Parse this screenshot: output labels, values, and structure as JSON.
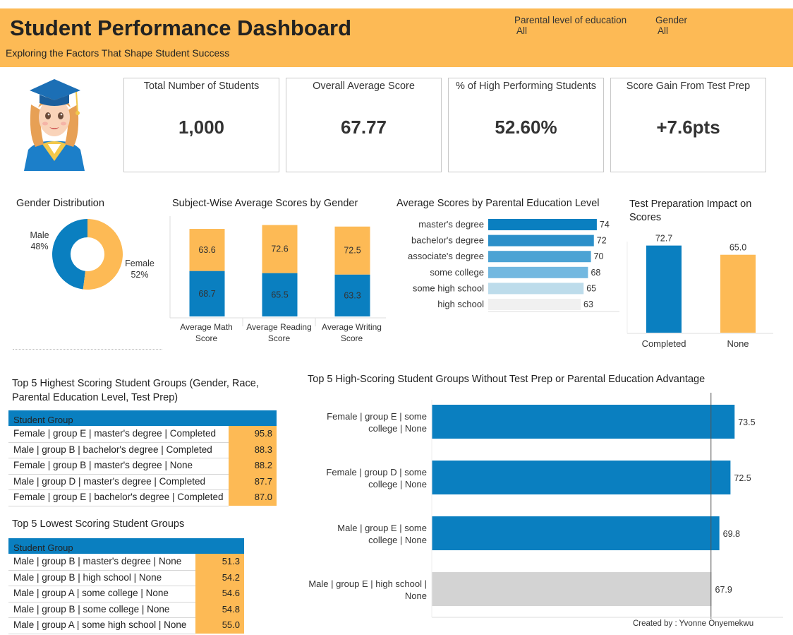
{
  "header": {
    "title": "Student Performance Dashboard",
    "subtitle": "Exploring the Factors That Shape Student Success",
    "filters": [
      {
        "label": "Parental level of education",
        "value": "All"
      },
      {
        "label": "Gender",
        "value": "All"
      }
    ]
  },
  "kpis": [
    {
      "label": "Total Number of  Students",
      "value": "1,000"
    },
    {
      "label": "Overall Average Score",
      "value": "67.77"
    },
    {
      "label": "% of High Performing Students",
      "value": "52.60%"
    },
    {
      "label": "Score Gain From Test Prep",
      "value": "+7.6pts"
    }
  ],
  "colors": {
    "orange": "#FDBA55",
    "blue": "#0A7FC0",
    "gray": "#D3D3D3"
  },
  "tables": {
    "top": {
      "title": "Top 5 Highest Scoring Student Groups (Gender, Race, Parental Education Level, Test Prep)",
      "header": "Student Group",
      "rows": [
        {
          "group": "Female | group E | master's degree | Completed",
          "value": "95.8"
        },
        {
          "group": "Male | group B | bachelor's degree | Completed",
          "value": "88.3"
        },
        {
          "group": "Female | group B | master's degree | None",
          "value": "88.2"
        },
        {
          "group": "Male | group D | master's degree | Completed",
          "value": "87.7"
        },
        {
          "group": "Female | group E | bachelor's degree | Completed",
          "value": "87.0"
        }
      ]
    },
    "bottom": {
      "title": "Top 5 Lowest Scoring Student Groups",
      "header": "Student Group",
      "rows": [
        {
          "group": "Male | group B | master's degree | None",
          "value": "51.3"
        },
        {
          "group": "Male | group B | high school | None",
          "value": "54.2"
        },
        {
          "group": "Male | group A | some college | None",
          "value": "54.6"
        },
        {
          "group": "Male | group B | some college | None",
          "value": "54.8"
        },
        {
          "group": "Male | group A | some high school | None",
          "value": "55.0"
        }
      ]
    }
  },
  "footer": {
    "credit": "Created by : Yvonne Onyemekwu"
  },
  "chart_data": [
    {
      "type": "pie",
      "title": "Gender Distribution",
      "donut": true,
      "categories": [
        "Male",
        "Female"
      ],
      "values": [
        48,
        52
      ],
      "labels": [
        "48%",
        "52%"
      ],
      "colors": [
        "#0A7FC0",
        "#FDBA55"
      ]
    },
    {
      "type": "bar",
      "title": "Subject-Wise Average Scores by Gender",
      "stacked": true,
      "categories": [
        "Average Math Score",
        "Average Reading Score",
        "Average Writing Score"
      ],
      "series": [
        {
          "values": [
            68.7,
            65.5,
            63.3
          ],
          "color": "#0A7FC0"
        },
        {
          "values": [
            63.6,
            72.6,
            72.5
          ],
          "color": "#FDBA55"
        }
      ]
    },
    {
      "type": "bar",
      "orientation": "horizontal",
      "title": "Average Scores by Parental Education Level",
      "categories": [
        "master's degree",
        "bachelor's degree",
        "associate's degree",
        "some college",
        "some high school",
        "high school"
      ],
      "values": [
        74,
        72,
        70,
        68,
        65,
        63
      ],
      "colors": [
        "#0A7FC0",
        "#2B8FC9",
        "#4CA3D4",
        "#72B8E0",
        "#BDDCEB",
        "#F0F0F0"
      ]
    },
    {
      "type": "bar",
      "title": "Test Preparation Impact on Scores",
      "categories": [
        "Completed",
        "None"
      ],
      "values": [
        72.7,
        65.0
      ],
      "labels": [
        "72.7",
        "65.0"
      ],
      "colors": [
        "#0A7FC0",
        "#FDBA55"
      ]
    },
    {
      "type": "bar",
      "orientation": "horizontal",
      "title": "Top 5 High-Scoring Student Groups Without Test Prep or Parental Education Advantage",
      "categories": [
        "Female | group E | some college | None",
        "Female | group D | some college | None",
        "Male | group E | some college | None",
        "Male | group E | high school | None"
      ],
      "values": [
        73.5,
        72.5,
        69.8,
        67.9
      ],
      "labels": [
        "73.5",
        "72.5",
        "69.8",
        "67.9"
      ],
      "colors": [
        "#0A7FC0",
        "#0A7FC0",
        "#0A7FC0",
        "#D3D3D3"
      ],
      "reference_line": 67.77
    }
  ]
}
